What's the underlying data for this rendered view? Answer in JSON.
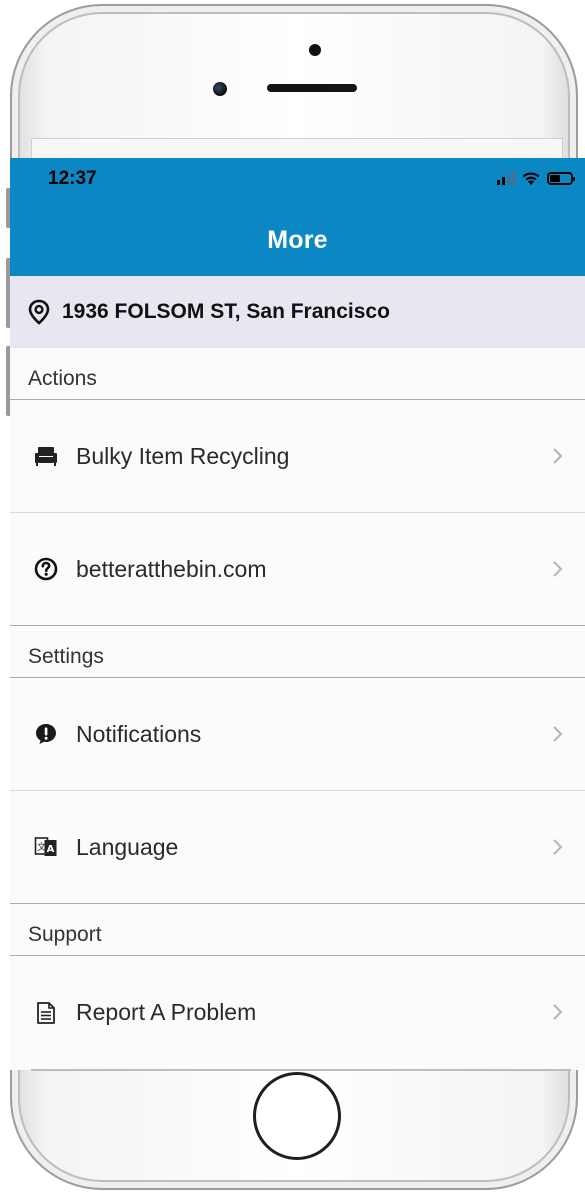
{
  "status_bar": {
    "time": "12:37"
  },
  "nav": {
    "title": "More"
  },
  "address": {
    "text": "1936 FOLSOM ST, San Francisco",
    "icon": "location-pin-icon"
  },
  "sections": [
    {
      "header": "Actions",
      "items": [
        {
          "label": "Bulky Item Recycling",
          "icon": "couch-icon"
        },
        {
          "label": "betteratthebin.com",
          "icon": "question-circle-icon"
        }
      ]
    },
    {
      "header": "Settings",
      "items": [
        {
          "label": "Notifications",
          "icon": "alert-bubble-icon"
        },
        {
          "label": "Language",
          "icon": "translate-icon"
        }
      ]
    },
    {
      "header": "Support",
      "items": [
        {
          "label": "Report A Problem",
          "icon": "document-icon"
        }
      ]
    }
  ],
  "colors": {
    "accent": "#0b87c4",
    "address_bg": "#e8e6f0"
  }
}
